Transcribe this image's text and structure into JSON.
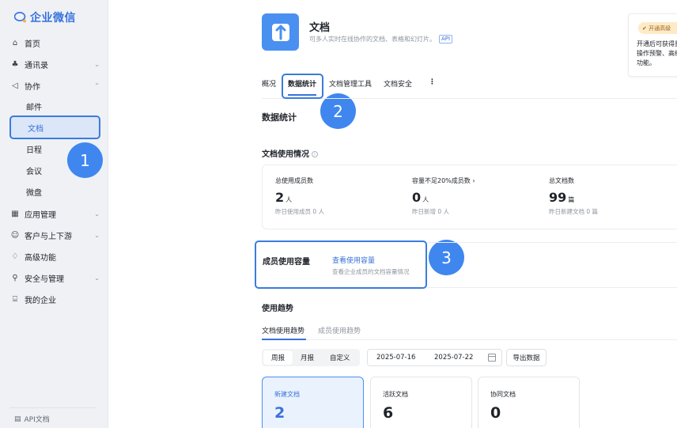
{
  "sidebar": {
    "brand": "企业微信",
    "items": [
      {
        "label": "首页",
        "icon": "home-icon"
      },
      {
        "label": "通讯录",
        "icon": "contacts-icon"
      },
      {
        "label": "协作",
        "icon": "collab-icon"
      },
      {
        "label": "应用管理",
        "icon": "apps-icon"
      },
      {
        "label": "客户与上下游",
        "icon": "customer-icon"
      },
      {
        "label": "高级功能",
        "icon": "advanced-icon"
      },
      {
        "label": "安全与管理",
        "icon": "security-icon"
      },
      {
        "label": "我的企业",
        "icon": "company-icon"
      }
    ],
    "sub_items": [
      "邮件",
      "文档",
      "日程",
      "会议",
      "微盘"
    ],
    "active_sub": "文档",
    "api_docs": "API文档"
  },
  "badges": [
    "1",
    "2",
    "3"
  ],
  "header": {
    "title": "文档",
    "description": "可多人实时在线协作的文档、表格和幻灯片。",
    "api_tag": "API"
  },
  "promo": {
    "button": "开通高级",
    "text": "开通后可获得量操作预警、高级功能。"
  },
  "tabs": [
    "概况",
    "数据统计",
    "文档管理工具",
    "文档安全"
  ],
  "tabs_more": "⋮",
  "active_tab": "数据统计",
  "section_title": "数据统计",
  "usage": {
    "title": "文档使用情况",
    "info": "i",
    "stats": [
      {
        "label": "总使用成员数",
        "value": "2",
        "unit": "人",
        "sub": "昨日使用成员 0 人"
      },
      {
        "label": "容量不足20%成员数 ›",
        "value": "0",
        "unit": "人",
        "sub": "昨日新增 0 人"
      },
      {
        "label": "总文档数",
        "value": "99",
        "unit": "篇",
        "sub": "昨日新建文档 0 篇"
      }
    ]
  },
  "capacity": {
    "title": "成员使用容量",
    "link": "查看使用容量",
    "desc": "查看企业成员的文档容量情况"
  },
  "trend": {
    "title": "使用趋势",
    "tabs": [
      "文档使用趋势",
      "成员使用趋势"
    ],
    "active_tab": "文档使用趋势",
    "periods": [
      "周报",
      "月报",
      "自定义"
    ],
    "active_period": "周报",
    "date_start": "2025-07-16",
    "date_end": "2025-07-22",
    "export": "导出数据",
    "metrics": [
      {
        "label": "新建文档",
        "value": "2"
      },
      {
        "label": "活跃文档",
        "value": "6"
      },
      {
        "label": "协同文档",
        "value": "0"
      }
    ]
  }
}
